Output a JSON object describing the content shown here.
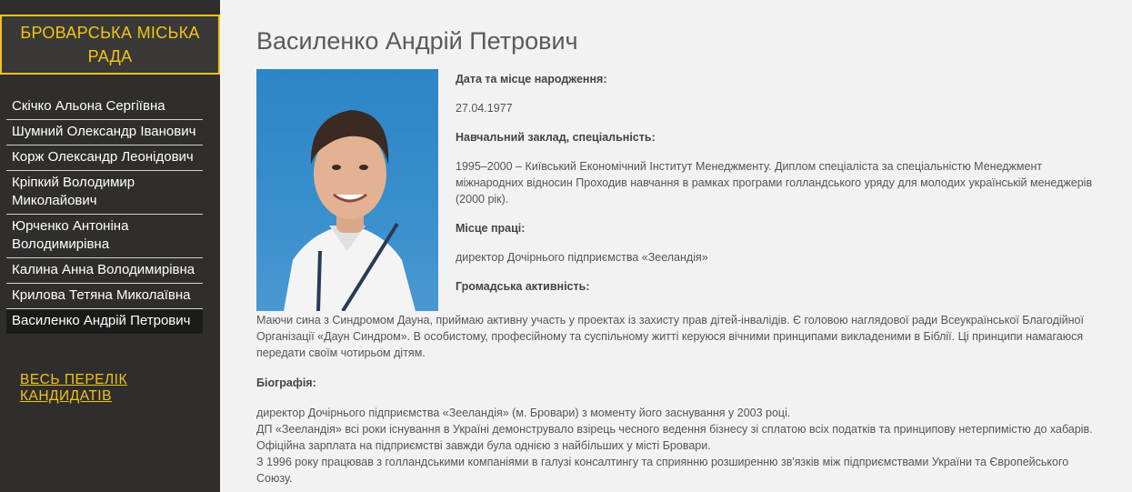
{
  "sidebar": {
    "site_title": "БРОВАРСЬКА МІСЬКА РАДА",
    "candidates": [
      "Скічко Альона Сергіївна",
      "Шумний Олександр Іванович",
      "Корж Олександр Леонідович",
      "Кріпкий Володимир Миколайович",
      "Юрченко Антоніна Володимирівна",
      "Калина Анна Володимирівна",
      "Крилова Тетяна Миколаївна",
      "Василенко Андрій Петрович"
    ],
    "all_candidates_link": "ВЕСЬ ПЕРЕЛІК КАНДИДАТІВ"
  },
  "main": {
    "title": "Василенко Андрій Петрович",
    "birth_heading": "Дата та місце народження:",
    "birth_value": "27.04.1977",
    "education_heading": "Навчальний заклад, спеціальність:",
    "education_value": "1995–2000 – Київський Економічний Інститут Менеджменту. Диплом спеціаліста за спеціальністю Менеджмент міжнародних відносин Проходив навчання в рамках програми голландського уряду для молодих українській менеджерів (2000 рік).",
    "work_heading": "Місце праці:",
    "work_value": "директор Дочірнього підприємства «Зееландія»",
    "public_heading": "Громадська активність:",
    "public_value": "Маючи сина з Синдромом Дауна, приймаю активну участь у проектах із захисту прав дітей-інвалідів. Є головою наглядової ради Всеукраїнської Благодійної Організації «Даун Синдром». В особистому, професійному та суспільному житті керуюся вічними принципами викладеними в Біблії. Ці принципи намагаюся передати своїм чотирьом дітям.",
    "bio_heading": "Біографія:",
    "bio_lines": [
      "директор Дочірнього підприємства «Зееландія» (м. Бровари) з моменту його заснування у 2003 році.",
      "ДП «Зееландія» всі роки існування в Україні демонструвало взірець чесного ведення бізнесу зі сплатою всіх податків та принципову нетерпимістю до хабарів. Офіційна зарплата на підприємстві завжди була однією з найбільших у місті Бровари.",
      "З 1996 року працював з голландськими компаніями в галузі консалтингу та сприянню розширенню зв'язків між підприємствами України та Європейського Союзу."
    ]
  },
  "colors": {
    "accent": "#f0c419",
    "sidebar_bg": "#2f2e2c",
    "page_bg": "#f2f2f2",
    "active_item_bg": "#1b1b1a"
  }
}
